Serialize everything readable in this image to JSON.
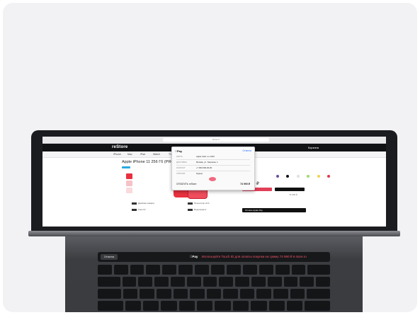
{
  "touchbar": {
    "esc_label": "Отмена",
    "apple_pay_label": "Pay",
    "prompt_text": "Используйте Touch ID для оплаты покупки на сумму 74 990 ₽ в store.ru"
  },
  "browser": {
    "url": "store.ru"
  },
  "site": {
    "logo": "reStore",
    "nav_items": [
      "iPhone",
      "Mac",
      "iPad",
      "Watch",
      "TV",
      "Music"
    ],
    "page_title": "Apple iPhone 11 256 Гб (PRODUCT)RED",
    "price": "74 990 ₽",
    "old_price": "79 990 ₽",
    "cart_label": "Корзина",
    "colors": [
      "#6b4fa0",
      "#111111",
      "#e0e0e0",
      "#a6d86b",
      "#f3d54c",
      "#e2394a"
    ],
    "features": [
      "Двойная камера",
      "Face ID",
      "Процессор A13",
      "Водозащита"
    ],
    "apple_pay_promo": "Оплата Apple Pay"
  },
  "pay_sheet": {
    "title": "Pay",
    "cancel_label": "Отмена",
    "rows": [
      {
        "label": "КАРТА",
        "value": "Apple Card •••• 1234"
      },
      {
        "label": "ДОСТАВКА",
        "value": "Москва, ул. Тверская, 1"
      },
      {
        "label": "КОНТАКТ",
        "value": "+7 900 000-00-00"
      },
      {
        "label": "СПОСОБ",
        "value": "Курьер"
      }
    ],
    "total_label": "ОПЛАТИТЬ reStore",
    "total_value": "74 990 ₽"
  }
}
